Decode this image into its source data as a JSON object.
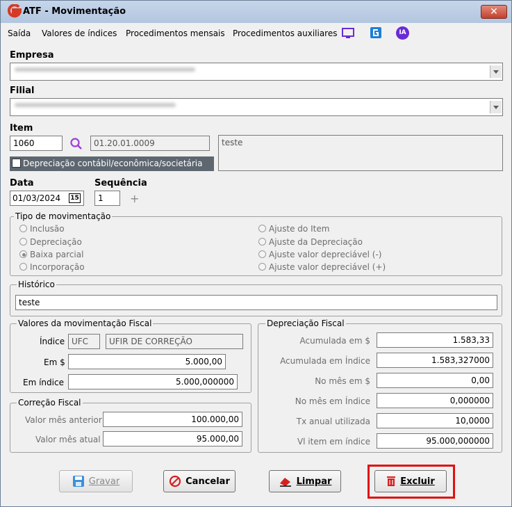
{
  "window": {
    "title": "ATF - Movimentação",
    "close_label": "✕"
  },
  "menu": {
    "items": [
      "Saída",
      "Valores de índices",
      "Procedimentos mensais",
      "Procedimentos auxiliares"
    ],
    "icon_ia_label": "IA"
  },
  "empresa": {
    "label": "Empresa"
  },
  "filial": {
    "label": "Filial"
  },
  "item": {
    "label": "Item",
    "code": "1060",
    "account": "01.20.01.0009",
    "description": "teste",
    "checkbox_label": "Depreciação contábil/econômica/societária"
  },
  "data": {
    "label": "Data",
    "value": "01/03/2024",
    "calendar_label": "15"
  },
  "sequencia": {
    "label": "Sequência",
    "value": "1"
  },
  "tipo": {
    "title": "Tipo de movimentação",
    "left": [
      "Inclusão",
      "Depreciação",
      "Baixa parcial",
      "Incorporação"
    ],
    "right": [
      "Ajuste do Item",
      "Ajuste da Depreciação",
      "Ajuste valor depreciável (-)",
      "Ajuste valor depreciável (+)"
    ]
  },
  "historico": {
    "title": "Histórico",
    "value": "teste"
  },
  "valores": {
    "title": "Valores da movimentação Fiscal",
    "indice_label": "Índice",
    "indice_code": "UFC",
    "indice_name": "UFIR DE CORREÇÃO",
    "em_rs_label": "Em $",
    "em_rs_value": "5.000,00",
    "em_indice_label": "Em índice",
    "em_indice_value": "5.000,000000"
  },
  "correcao": {
    "title": "Correção Fiscal",
    "anterior_label": "Valor mês anterior",
    "anterior_value": "100.000,00",
    "atual_label": "Valor mês atual",
    "atual_value": "95.000,00"
  },
  "depreciacao": {
    "title": "Depreciação Fiscal",
    "rows": [
      {
        "label": "Acumulada em $",
        "value": "1.583,33"
      },
      {
        "label": "Acumulada em Índice",
        "value": "1.583,327000"
      },
      {
        "label": "No mês em $",
        "value": "0,00"
      },
      {
        "label": "No mês em Índice",
        "value": "0,000000"
      },
      {
        "label": "Tx anual utilizada",
        "value": "10,0000"
      },
      {
        "label": "Vl item em índice",
        "value": "95.000,000000"
      }
    ]
  },
  "buttons": {
    "gravar": "Gravar",
    "cancelar": "Cancelar",
    "limpar": "Limpar",
    "excluir": "Excluir"
  }
}
